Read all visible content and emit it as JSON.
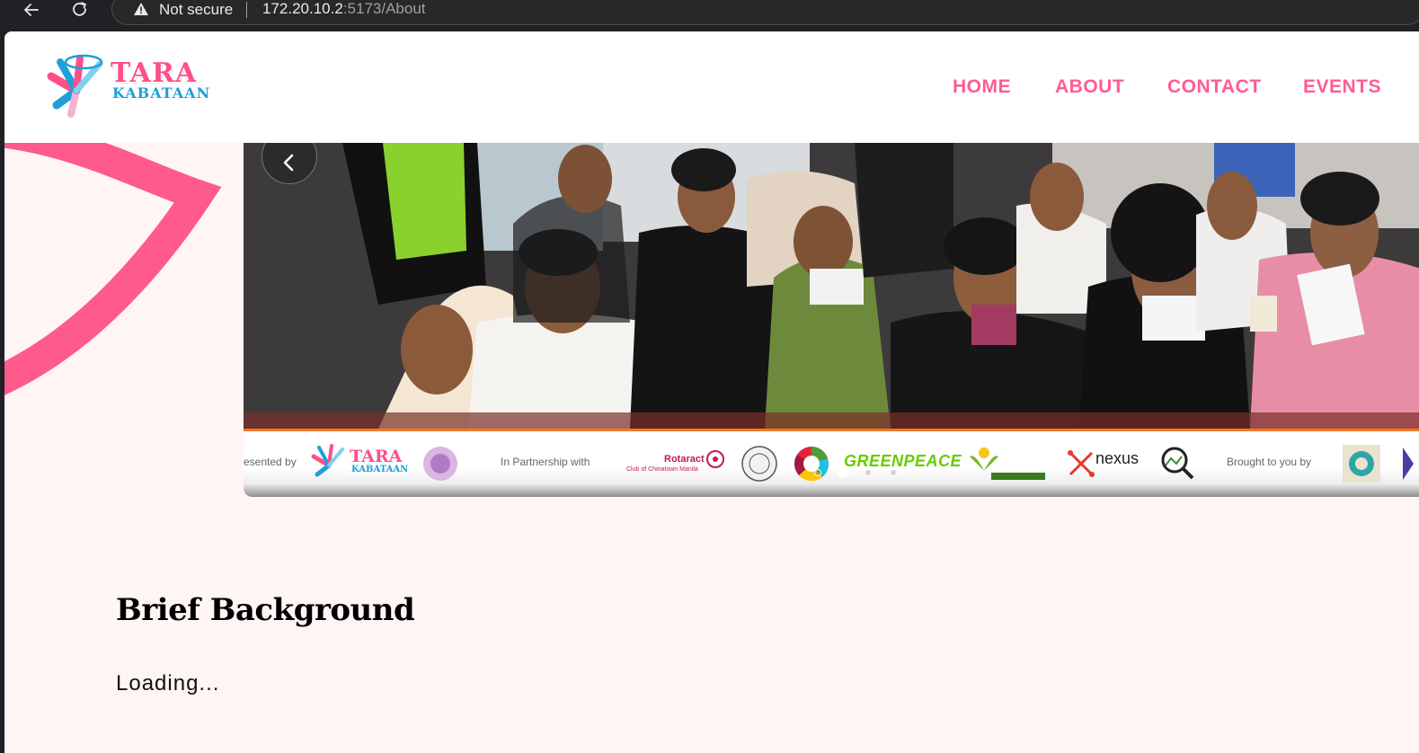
{
  "browser": {
    "security_label": "Not secure",
    "url_host": "172.20.10.2",
    "url_path": ":5173/About"
  },
  "header": {
    "logo": {
      "line1": "TARA",
      "line2": "KABATAAN"
    },
    "nav": [
      "HOME",
      "ABOUT",
      "CONTACT",
      "EVENTS"
    ]
  },
  "carousel": {
    "slide_count": 4,
    "active_slide": 2,
    "banner": {
      "presented_by": "esented by",
      "logo_tara_line1": "TARA",
      "logo_tara_line2": "KABATAAN",
      "partnership": "In Partnership with",
      "rotaract": "Rotaract",
      "rotaract_sub": "Club of Chinatown Manila",
      "greenpeace": "GREENPEACE",
      "nexus": "nexus",
      "brought_by": "Brought to you by"
    }
  },
  "content": {
    "heading": "Brief Background",
    "body": "Loading..."
  },
  "colors": {
    "brand_pink": "#ff5c8f",
    "brand_blue": "#1da0d8",
    "page_bg": "#fef5f4",
    "chrome_bg": "#202124"
  }
}
